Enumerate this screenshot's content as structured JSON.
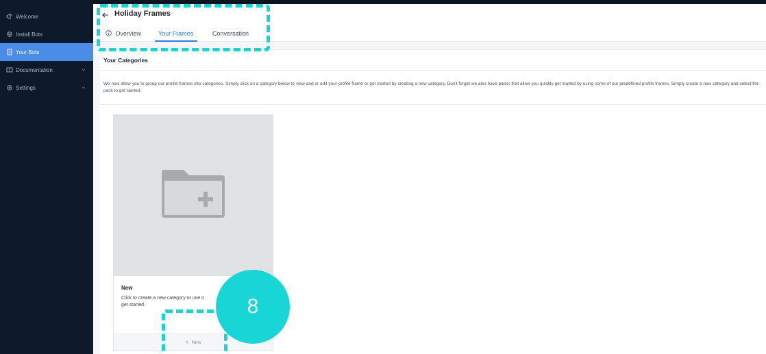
{
  "sidebar": {
    "items": [
      {
        "label": "Welcome",
        "icon": "megaphone-icon"
      },
      {
        "label": "Install Bots",
        "icon": "gear-icon"
      },
      {
        "label": "Your Bots",
        "icon": "document-icon",
        "active": true
      },
      {
        "label": "Documentation",
        "icon": "book-icon",
        "expandable": true
      },
      {
        "label": "Settings",
        "icon": "gear-icon",
        "expandable": true
      }
    ]
  },
  "header": {
    "title": "Holiday Frames",
    "tabs": [
      {
        "label": "Overview",
        "icon": "info-icon"
      },
      {
        "label": "Your Frames",
        "active": true
      },
      {
        "label": "Conversation"
      }
    ]
  },
  "categories": {
    "heading": "Your Categories",
    "description": "We now allow you to group our profile frames into categories. Simply click on a category below to view and or edit your profile frame or get started by creating a new category. Don't forget we also have packs that allow you quickly get started by using some of our predefined profile frames. Simply create a new category and select the pack to get started."
  },
  "card": {
    "title": "New",
    "text": "Click to create a new category or use o\nget started.",
    "button_label": "New",
    "image_icon": "folder-plus-icon"
  },
  "overlay": {
    "step_number": "8",
    "accent_color": "#19d6d6"
  }
}
